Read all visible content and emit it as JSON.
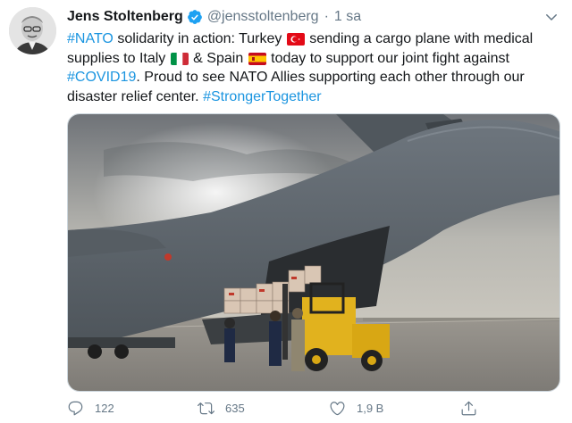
{
  "tweet": {
    "author_name": "Jens Stoltenberg",
    "handle": "@jensstoltenberg",
    "separator": "·",
    "time": "1 sa",
    "verified": true,
    "text": {
      "line1_hashtag": "#NATO",
      "line1_a": " solidarity in action: Turkey ",
      "line1_b": " sending a cargo plane with medical",
      "line2_a": "supplies to Italy ",
      "line2_b": " & Spain ",
      "line2_c": " today to support our joint fight against",
      "line3_hashtag": "#COVID19",
      "line3_a": ". Proud to see NATO Allies supporting each other through our",
      "line4_a": "disaster relief center. ",
      "line4_hashtag": "#StrongerTogether"
    },
    "flags": [
      "turkey-flag",
      "italy-flag",
      "spain-flag"
    ],
    "media": {
      "description_icon": "cargo-plane-photo",
      "tail_number_text": ""
    },
    "actions": {
      "reply_count": "122",
      "retweet_count": "635",
      "like_count": "1,9 B",
      "share_label": ""
    }
  },
  "colors": {
    "link": "#1b95e0",
    "verified": "#1da1f2",
    "muted": "#657786",
    "text": "#14171a"
  }
}
